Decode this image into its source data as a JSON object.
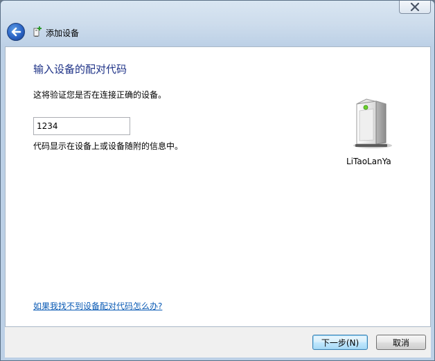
{
  "window": {
    "title": "添加设备"
  },
  "page": {
    "heading": "输入设备的配对代码",
    "description": "这将验证您是否在连接正确的设备。",
    "code_value": "1234",
    "hint": "代码显示在设备上或设备随附的信息中。",
    "help_link": "如果我找不到设备配对代码怎么办?"
  },
  "device": {
    "name": "LiTaoLanYa"
  },
  "buttons": {
    "next": "下一步(N)",
    "cancel": "取消"
  },
  "icons": {
    "close": "close-icon",
    "back": "back-arrow-icon",
    "wizard": "add-device-icon",
    "device": "device-tower-icon"
  },
  "colors": {
    "heading": "#1e3287",
    "link": "#0b5bb5"
  }
}
